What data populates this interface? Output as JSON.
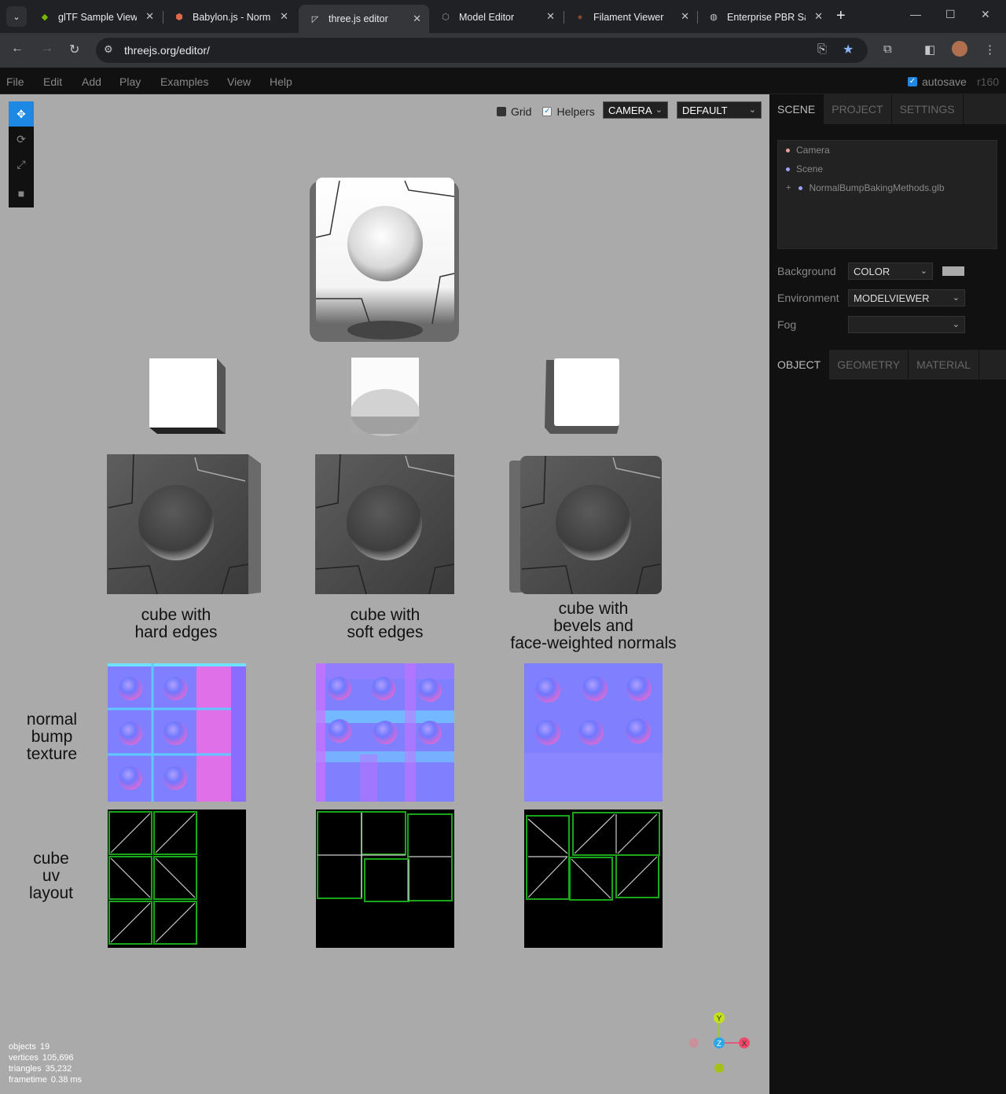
{
  "browser": {
    "tabs": [
      {
        "title": "glTF Sample Viewer"
      },
      {
        "title": "Babylon.js - Normal"
      },
      {
        "title": "three.js editor"
      },
      {
        "title": "Model Editor"
      },
      {
        "title": "Filament Viewer"
      },
      {
        "title": "Enterprise PBR Sample"
      }
    ],
    "url": "threejs.org/editor/"
  },
  "menubar": {
    "items": [
      "File",
      "Edit",
      "Add",
      "Play",
      "Examples",
      "View",
      "Help"
    ],
    "autosave_label": "autosave",
    "revision": "r160"
  },
  "viewport": {
    "grid_label": "Grid",
    "helpers_label": "Helpers",
    "camera_select": "CAMERA",
    "shading_select": "DEFAULT",
    "captions": [
      "cube with\nhard edges",
      "cube with\nsoft edges",
      "cube with\nbevels and\nface-weighted normals"
    ],
    "row_labels": [
      "normal\nbump\ntexture",
      "cube\nuv\nlayout"
    ],
    "info": {
      "objects_label": "objects",
      "objects": "19",
      "vertices_label": "vertices",
      "vertices": "105,696",
      "triangles_label": "triangles",
      "triangles": "35,232",
      "frametime_label": "frametime",
      "frametime": "0.38 ms"
    },
    "gizmo": {
      "x": "X",
      "y": "Y",
      "z": "Z"
    }
  },
  "sidebar": {
    "top_tabs": [
      "SCENE",
      "PROJECT",
      "SETTINGS"
    ],
    "outliner": [
      {
        "label": "Camera",
        "color": "#e5a0a0"
      },
      {
        "label": "Scene",
        "color": "#a0a0ff"
      },
      {
        "label": "NormalBumpBakingMethods.glb",
        "color": "#a0a0ff",
        "prefix": "+"
      }
    ],
    "background_label": "Background",
    "background_value": "COLOR",
    "background_color": "#aaaaaa",
    "environment_label": "Environment",
    "environment_value": "MODELVIEWER",
    "fog_label": "Fog",
    "fog_value": "",
    "bottom_tabs": [
      "OBJECT",
      "GEOMETRY",
      "MATERIAL"
    ]
  }
}
